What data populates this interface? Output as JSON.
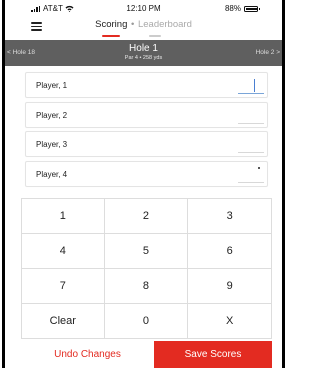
{
  "status_bar": {
    "carrier": "AT&T",
    "time": "12:10 PM",
    "battery": "88%",
    "battery_level": 0.88
  },
  "header": {
    "tabs": [
      {
        "label": "Scoring",
        "active": true
      },
      {
        "label": "Leaderboard",
        "active": false
      }
    ],
    "separator": "•"
  },
  "hole_nav": {
    "prev": "< Hole 18",
    "title": "Hole 1",
    "subtitle": "Par 4 • 258 yds",
    "next": "Hole 2 >"
  },
  "players": [
    {
      "name": "Player, 1",
      "score": ""
    },
    {
      "name": "Player, 2",
      "score": ""
    },
    {
      "name": "Player, 3",
      "score": ""
    },
    {
      "name": "Player, 4",
      "score": ""
    }
  ],
  "keypad": {
    "keys": [
      "1",
      "2",
      "3",
      "4",
      "5",
      "6",
      "7",
      "8",
      "9",
      "Clear",
      "0",
      "X"
    ]
  },
  "actions": {
    "undo": "Undo Changes",
    "save": "Save Scores"
  },
  "colors": {
    "accent": "#e32b21",
    "hole_bar": "#5f5f5f"
  }
}
